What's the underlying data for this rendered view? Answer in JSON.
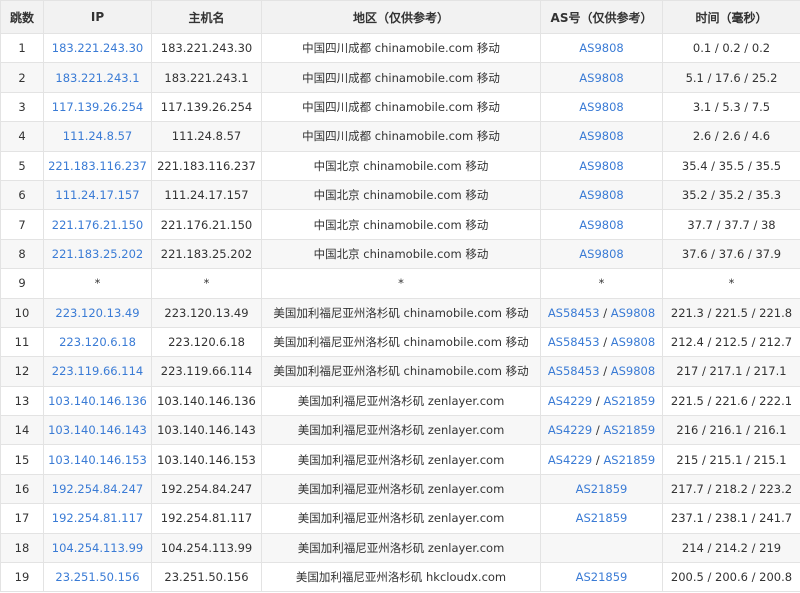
{
  "headers": {
    "hop": "跳数",
    "ip": "IP",
    "host": "主机名",
    "region": "地区（仅供参考）",
    "as": "AS号（仅供参考）",
    "time": "时间（毫秒）"
  },
  "rows": [
    {
      "hop": "1",
      "ip": "183.221.243.30",
      "host": "183.221.243.30",
      "region": "中国四川成都 chinamobile.com 移动",
      "as": [
        "AS9808"
      ],
      "time": "0.1 / 0.2 / 0.2"
    },
    {
      "hop": "2",
      "ip": "183.221.243.1",
      "host": "183.221.243.1",
      "region": "中国四川成都 chinamobile.com 移动",
      "as": [
        "AS9808"
      ],
      "time": "5.1 / 17.6 / 25.2"
    },
    {
      "hop": "3",
      "ip": "117.139.26.254",
      "host": "117.139.26.254",
      "region": "中国四川成都 chinamobile.com 移动",
      "as": [
        "AS9808"
      ],
      "time": "3.1 / 5.3 / 7.5"
    },
    {
      "hop": "4",
      "ip": "111.24.8.57",
      "host": "111.24.8.57",
      "region": "中国四川成都 chinamobile.com 移动",
      "as": [
        "AS9808"
      ],
      "time": "2.6 / 2.6 / 4.6"
    },
    {
      "hop": "5",
      "ip": "221.183.116.237",
      "host": "221.183.116.237",
      "region": "中国北京 chinamobile.com 移动",
      "as": [
        "AS9808"
      ],
      "time": "35.4 / 35.5 / 35.5"
    },
    {
      "hop": "6",
      "ip": "111.24.17.157",
      "host": "111.24.17.157",
      "region": "中国北京 chinamobile.com 移动",
      "as": [
        "AS9808"
      ],
      "time": "35.2 / 35.2 / 35.3"
    },
    {
      "hop": "7",
      "ip": "221.176.21.150",
      "host": "221.176.21.150",
      "region": "中国北京 chinamobile.com 移动",
      "as": [
        "AS9808"
      ],
      "time": "37.7 / 37.7 / 38"
    },
    {
      "hop": "8",
      "ip": "221.183.25.202",
      "host": "221.183.25.202",
      "region": "中国北京 chinamobile.com 移动",
      "as": [
        "AS9808"
      ],
      "time": "37.6 / 37.6 / 37.9"
    },
    {
      "hop": "9",
      "ip": "*",
      "host": "*",
      "region": "*",
      "as": [
        "*"
      ],
      "time": "*"
    },
    {
      "hop": "10",
      "ip": "223.120.13.49",
      "host": "223.120.13.49",
      "region": "美国加利福尼亚州洛杉矶 chinamobile.com 移动",
      "as": [
        "AS58453",
        "AS9808"
      ],
      "time": "221.3 / 221.5 / 221.8"
    },
    {
      "hop": "11",
      "ip": "223.120.6.18",
      "host": "223.120.6.18",
      "region": "美国加利福尼亚州洛杉矶 chinamobile.com 移动",
      "as": [
        "AS58453",
        "AS9808"
      ],
      "time": "212.4 / 212.5 / 212.7"
    },
    {
      "hop": "12",
      "ip": "223.119.66.114",
      "host": "223.119.66.114",
      "region": "美国加利福尼亚州洛杉矶 chinamobile.com 移动",
      "as": [
        "AS58453",
        "AS9808"
      ],
      "time": "217 / 217.1 / 217.1"
    },
    {
      "hop": "13",
      "ip": "103.140.146.136",
      "host": "103.140.146.136",
      "region": "美国加利福尼亚州洛杉矶 zenlayer.com",
      "as": [
        "AS4229",
        "AS21859"
      ],
      "time": "221.5 / 221.6 / 222.1"
    },
    {
      "hop": "14",
      "ip": "103.140.146.143",
      "host": "103.140.146.143",
      "region": "美国加利福尼亚州洛杉矶 zenlayer.com",
      "as": [
        "AS4229",
        "AS21859"
      ],
      "time": "216 / 216.1 / 216.1"
    },
    {
      "hop": "15",
      "ip": "103.140.146.153",
      "host": "103.140.146.153",
      "region": "美国加利福尼亚州洛杉矶 zenlayer.com",
      "as": [
        "AS4229",
        "AS21859"
      ],
      "time": "215 / 215.1 / 215.1"
    },
    {
      "hop": "16",
      "ip": "192.254.84.247",
      "host": "192.254.84.247",
      "region": "美国加利福尼亚州洛杉矶 zenlayer.com",
      "as": [
        "AS21859"
      ],
      "time": "217.7 / 218.2 / 223.2"
    },
    {
      "hop": "17",
      "ip": "192.254.81.117",
      "host": "192.254.81.117",
      "region": "美国加利福尼亚州洛杉矶 zenlayer.com",
      "as": [
        "AS21859"
      ],
      "time": "237.1 / 238.1 / 241.7"
    },
    {
      "hop": "18",
      "ip": "104.254.113.99",
      "host": "104.254.113.99",
      "region": "美国加利福尼亚州洛杉矶 zenlayer.com",
      "as": [],
      "time": "214 / 214.2 / 219"
    },
    {
      "hop": "19",
      "ip": "23.251.50.156",
      "host": "23.251.50.156",
      "region": "美国加利福尼亚州洛杉矶 hkcloudx.com",
      "as": [
        "AS21859"
      ],
      "time": "200.5 / 200.6 / 200.8"
    }
  ],
  "colors": {
    "link": "#3a7bd5",
    "header_bg": "#f2f2f2",
    "border": "#e3e3e3",
    "stripe": "#f7f7f7"
  }
}
